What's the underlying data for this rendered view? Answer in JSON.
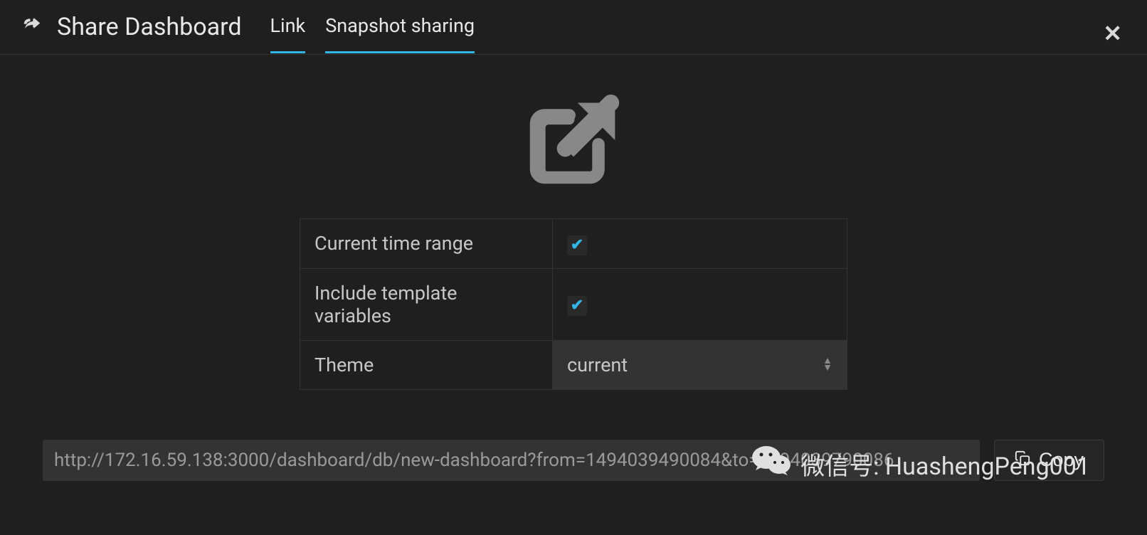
{
  "header": {
    "title": "Share Dashboard",
    "tabs": [
      {
        "label": "Link",
        "active": true
      },
      {
        "label": "Snapshot sharing",
        "active": false
      }
    ]
  },
  "options": {
    "current_time_range": {
      "label": "Current time range",
      "checked": true
    },
    "include_template_vars": {
      "label": "Include template variables",
      "checked": true
    },
    "theme": {
      "label": "Theme",
      "value": "current"
    }
  },
  "share": {
    "url": "http://172.16.59.138:3000/dashboard/db/new-dashboard?from=1494039490084&to=1494039790086",
    "copy_label": "Copy"
  },
  "watermark": {
    "text": "微信号: HuashengPeng001"
  }
}
